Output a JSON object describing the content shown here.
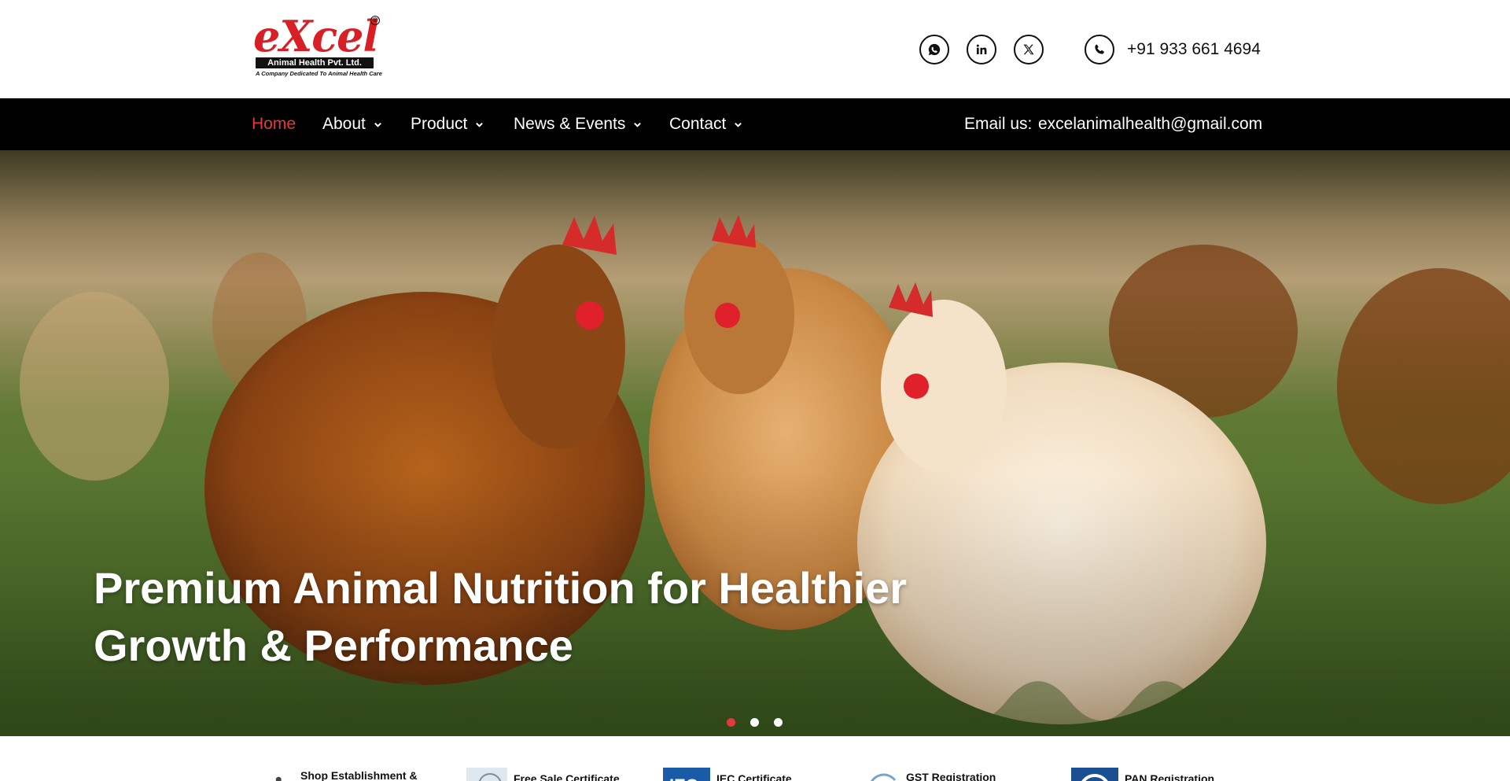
{
  "header": {
    "logo": {
      "wordmark": "eXcel",
      "registered": "®",
      "company": "Animal Health Pvt. Ltd.",
      "tagline": "A Company Dedicated To Animal Health Care"
    },
    "social_icons": [
      "whatsapp-icon",
      "linkedin-icon",
      "x-icon"
    ],
    "phone": "+91 933 661 4694"
  },
  "nav": {
    "items": [
      {
        "label": "Home",
        "active": true
      },
      {
        "label": "About",
        "dropdown": true
      },
      {
        "label": "Product",
        "dropdown": true
      },
      {
        "label": "News & Events",
        "dropdown": true
      },
      {
        "label": "Contact",
        "dropdown": true
      }
    ],
    "email_label": "Email us:",
    "email": "excelanimalhealth@gmail.com"
  },
  "hero": {
    "heading_line1": "Premium Animal Nutrition for Healthier",
    "heading_line2": "Growth & Performance",
    "slides": 3,
    "active_slide": 1
  },
  "certificates": [
    {
      "label": "Shop Establishment &"
    },
    {
      "label": "Free Sale Certificate"
    },
    {
      "label": "IEC Certificate"
    },
    {
      "label": "GST Registration"
    },
    {
      "label": "PAN Registration"
    }
  ],
  "colors": {
    "accent": "#e3393f",
    "brand_red": "#d81f26",
    "nav_bg": "#000000"
  }
}
